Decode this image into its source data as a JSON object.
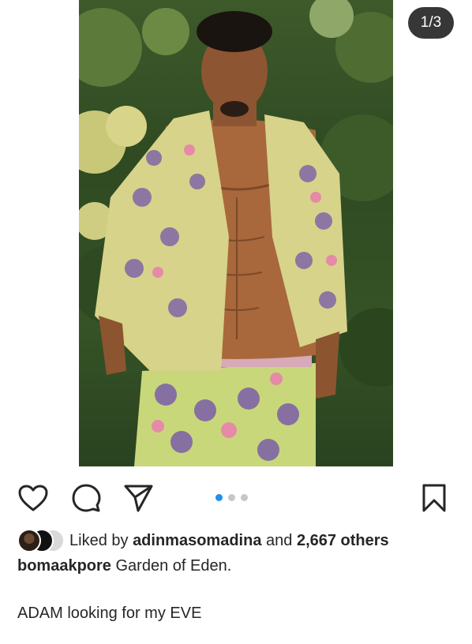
{
  "post": {
    "image_counter": "1/3",
    "carousel": {
      "count": 3,
      "active_index": 0
    },
    "actions": {
      "like_icon": "heart-icon",
      "comment_icon": "comment-bubble-icon",
      "share_icon": "send-paper-plane-icon",
      "save_icon": "bookmark-icon"
    },
    "likes": {
      "prefix": "Liked by",
      "user": "adinmasomadina",
      "connector": "and",
      "others": "2,667 others"
    },
    "caption": {
      "username": "bomaakpore",
      "text": "Garden of Eden.",
      "line2": "ADAM looking for my EVE"
    }
  },
  "colors": {
    "accent": "#1f8ff0",
    "text": "#262626",
    "dot_inactive": "#c7c7c7",
    "counter_bg": "#262626"
  }
}
